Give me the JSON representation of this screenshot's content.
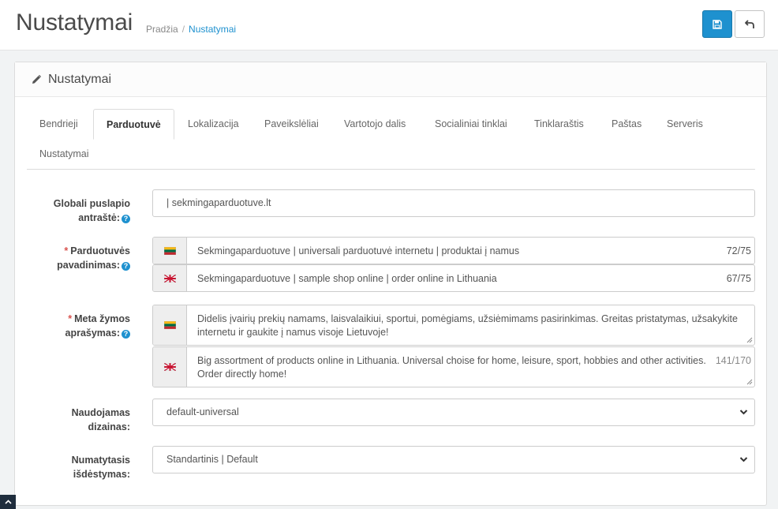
{
  "header": {
    "title": "Nustatymai",
    "breadcrumb": {
      "home": "Pradžia",
      "separator": "/",
      "current": "Nustatymai"
    },
    "save_icon": "save-icon",
    "back_icon": "undo-icon"
  },
  "panel": {
    "title": "Nustatymai",
    "icon": "pencil-icon"
  },
  "tabs": [
    {
      "label": "Bendrieji"
    },
    {
      "label": "Parduotuvė",
      "active": true
    },
    {
      "label": "Lokalizacija"
    },
    {
      "label": "Paveikslėliai"
    },
    {
      "label": "Vartotojo dalis"
    },
    {
      "label": "Socialiniai tinklai"
    },
    {
      "label": "Tinklaraštis"
    },
    {
      "label": "Paštas"
    },
    {
      "label": "Serveris"
    },
    {
      "label": "Nustatymai"
    }
  ],
  "form": {
    "global_title": {
      "label_line1": "Globali puslapio",
      "label_line2": "antraštė:",
      "value": "| sekmingaparduotuve.lt"
    },
    "store_name": {
      "required_mark": "*",
      "label_line1": "Parduotuvės",
      "label_line2": "pavadinimas:",
      "lt_value": "Sekmingaparduotuve | universali parduotuvė internetu | produktai į namus",
      "lt_counter": "72/75",
      "en_value": "Sekmingaparduotuve | sample shop online | order online in Lithuania",
      "en_counter": "67/75"
    },
    "meta_description": {
      "required_mark": "*",
      "label_line1": "Meta žymos",
      "label_line2": "aprašymas:",
      "lt_value": "Didelis įvairių prekių namams, laisvalaikiui, sportui, pomėgiams, užsiėmimams pasirinkimas. Greitas pristatymas, užsakykite internetu ir gaukite į namus visoje Lietuvoje!",
      "en_value": "Big assortment of products online in Lithuania. Universal choise for home, leisure, sport, hobbies and other activities. Order directly home!",
      "en_counter": "141/170"
    },
    "theme": {
      "label_line1": "Naudojamas",
      "label_line2": "dizainas:",
      "value": "default-universal"
    },
    "layout": {
      "label_line1": "Numatytasis",
      "label_line2": "išdėstymas:",
      "value": "Standartinis | Default"
    }
  },
  "languages": {
    "lt": "lithuania-flag-icon",
    "en": "uk-flag-icon"
  },
  "help_glyph": "?",
  "scroll_top_icon": "chevron-up-icon"
}
